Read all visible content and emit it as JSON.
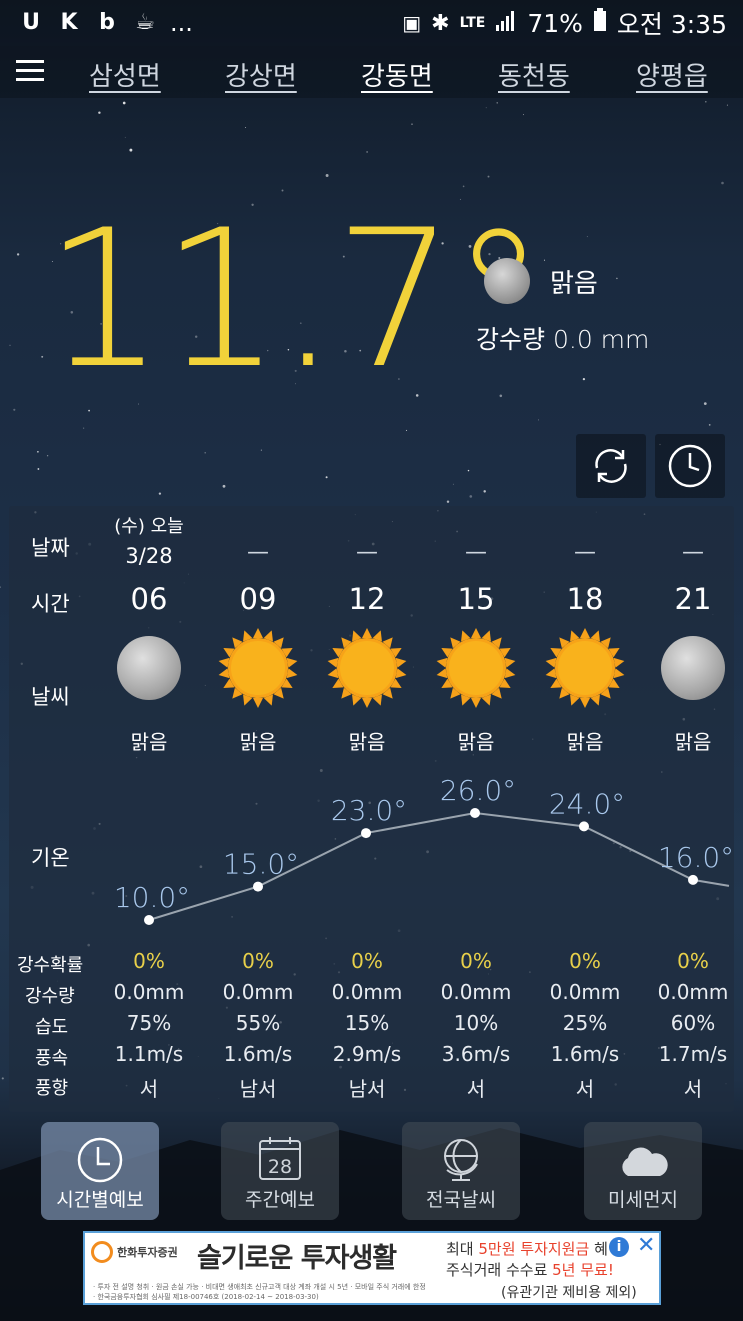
{
  "status": {
    "left_icons": [
      "u-app-icon",
      "k-app-icon",
      "b-app-icon",
      "coffee-icon"
    ],
    "more": "...",
    "network": "LTE",
    "battery": "71%",
    "time": "오전 3:35"
  },
  "nav": {
    "tabs": [
      {
        "label": "삼성면",
        "active": false
      },
      {
        "label": "강상면",
        "active": false
      },
      {
        "label": "강동면",
        "active": true
      },
      {
        "label": "동천동",
        "active": false
      },
      {
        "label": "양평읍",
        "active": false
      }
    ]
  },
  "current": {
    "temperature": "11.7°",
    "condition": "맑음",
    "precip_label": "강수량",
    "precip_value": "0.0 mm"
  },
  "forecast": {
    "labels": {
      "date": "날짜",
      "time": "시간",
      "weather": "날씨",
      "temp": "기온",
      "prob": "강수확률",
      "amount": "강수량",
      "humidity": "습도",
      "wind_speed": "풍속",
      "wind_dir": "풍향"
    },
    "today_day": "(수) 오늘",
    "today_date": "3/28",
    "dash": "—",
    "columns": [
      {
        "hour": "06",
        "icon": "moon",
        "cond": "맑음",
        "temp": "10.0°",
        "temp_value": 10.0,
        "prob": "0%",
        "amount": "0.0mm",
        "humidity": "75%",
        "wind_speed": "1.1m/s",
        "wind_dir": "서"
      },
      {
        "hour": "09",
        "icon": "sun",
        "cond": "맑음",
        "temp": "15.0°",
        "temp_value": 15.0,
        "prob": "0%",
        "amount": "0.0mm",
        "humidity": "55%",
        "wind_speed": "1.6m/s",
        "wind_dir": "남서"
      },
      {
        "hour": "12",
        "icon": "sun",
        "cond": "맑음",
        "temp": "23.0°",
        "temp_value": 23.0,
        "prob": "0%",
        "amount": "0.0mm",
        "humidity": "15%",
        "wind_speed": "2.9m/s",
        "wind_dir": "남서"
      },
      {
        "hour": "15",
        "icon": "sun",
        "cond": "맑음",
        "temp": "26.0°",
        "temp_value": 26.0,
        "prob": "0%",
        "amount": "0.0mm",
        "humidity": "10%",
        "wind_speed": "3.6m/s",
        "wind_dir": "서"
      },
      {
        "hour": "18",
        "icon": "sun",
        "cond": "맑음",
        "temp": "24.0°",
        "temp_value": 24.0,
        "prob": "0%",
        "amount": "0.0mm",
        "humidity": "25%",
        "wind_speed": "1.6m/s",
        "wind_dir": "서"
      },
      {
        "hour": "21",
        "icon": "moon",
        "cond": "맑음",
        "temp": "16.0°",
        "temp_value": 16.0,
        "prob": "0%",
        "amount": "0.0mm",
        "humidity": "60%",
        "wind_speed": "1.7m/s",
        "wind_dir": "서"
      }
    ]
  },
  "bottom_nav": {
    "items": [
      {
        "label": "시간별예보",
        "icon": "clock-icon",
        "active": true
      },
      {
        "label": "주간예보",
        "icon": "calendar-icon",
        "calendar_day": "28",
        "active": false
      },
      {
        "label": "전국날씨",
        "icon": "globe-icon",
        "active": false
      },
      {
        "label": "미세먼지",
        "icon": "cloud-icon",
        "active": false
      }
    ]
  },
  "ad": {
    "brand": "한화투자증권",
    "headline": "슬기로운 투자생활",
    "line1_prefix": "최대 ",
    "line1_highlight": "5만원 투자지원금",
    "line1_suffix": " 혜",
    "line2_prefix": "주식거래 수수료 ",
    "line2_highlight": "5년 무료!",
    "footnote1": "· 투자 전 설명 청취 · 원금 손실 가능 · 비대면 생애최초 신규고객 대상 계좌 개설 시 5년 · 모바일 주식 거래에 한정",
    "footnote2": "· 한국금융투자협회 심사필 제18-00746호 (2018-02-14 ~ 2018-03-30)",
    "disclaimer": "(유관기관 제비용 제외)",
    "colors": {
      "accent": "#e8412c",
      "brand_orange": "#f28c1e",
      "info_blue": "#2f7ad6"
    }
  }
}
